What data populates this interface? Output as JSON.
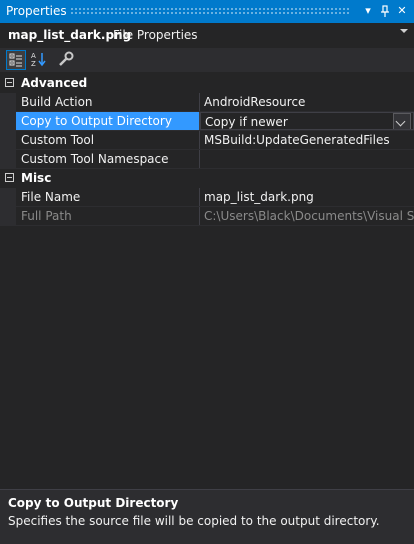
{
  "window": {
    "title": "Properties",
    "dropdown_icon": "▾",
    "pin_icon": "⊣",
    "close_icon": "✕"
  },
  "object": {
    "name": "map_list_dark.png",
    "type": "File Properties"
  },
  "toolbar": {
    "buttons": [
      {
        "name": "categorized-icon",
        "active": true
      },
      {
        "name": "alphabetical-icon",
        "active": false
      },
      {
        "name": "property-pages-wrench-icon",
        "active": false
      }
    ]
  },
  "categories": [
    {
      "label": "Advanced",
      "properties": [
        {
          "name": "Build Action",
          "value": "AndroidResource"
        },
        {
          "name": "Copy to Output Directory",
          "value": "Copy if newer"
        },
        {
          "name": "Custom Tool",
          "value": "MSBuild:UpdateGeneratedFiles"
        },
        {
          "name": "Custom Tool Namespace",
          "value": ""
        }
      ]
    },
    {
      "label": "Misc",
      "properties": [
        {
          "name": "File Name",
          "value": "map_list_dark.png"
        },
        {
          "name": "Full Path",
          "value": "C:\\Users\\Black\\Documents\\Visual Stud"
        }
      ]
    }
  ],
  "description": {
    "title": "Copy to Output Directory",
    "text": "Specifies the source file will be copied to the output directory."
  },
  "colors": {
    "accent": "#007acc",
    "selection": "#3399ff",
    "background": "#252526"
  }
}
